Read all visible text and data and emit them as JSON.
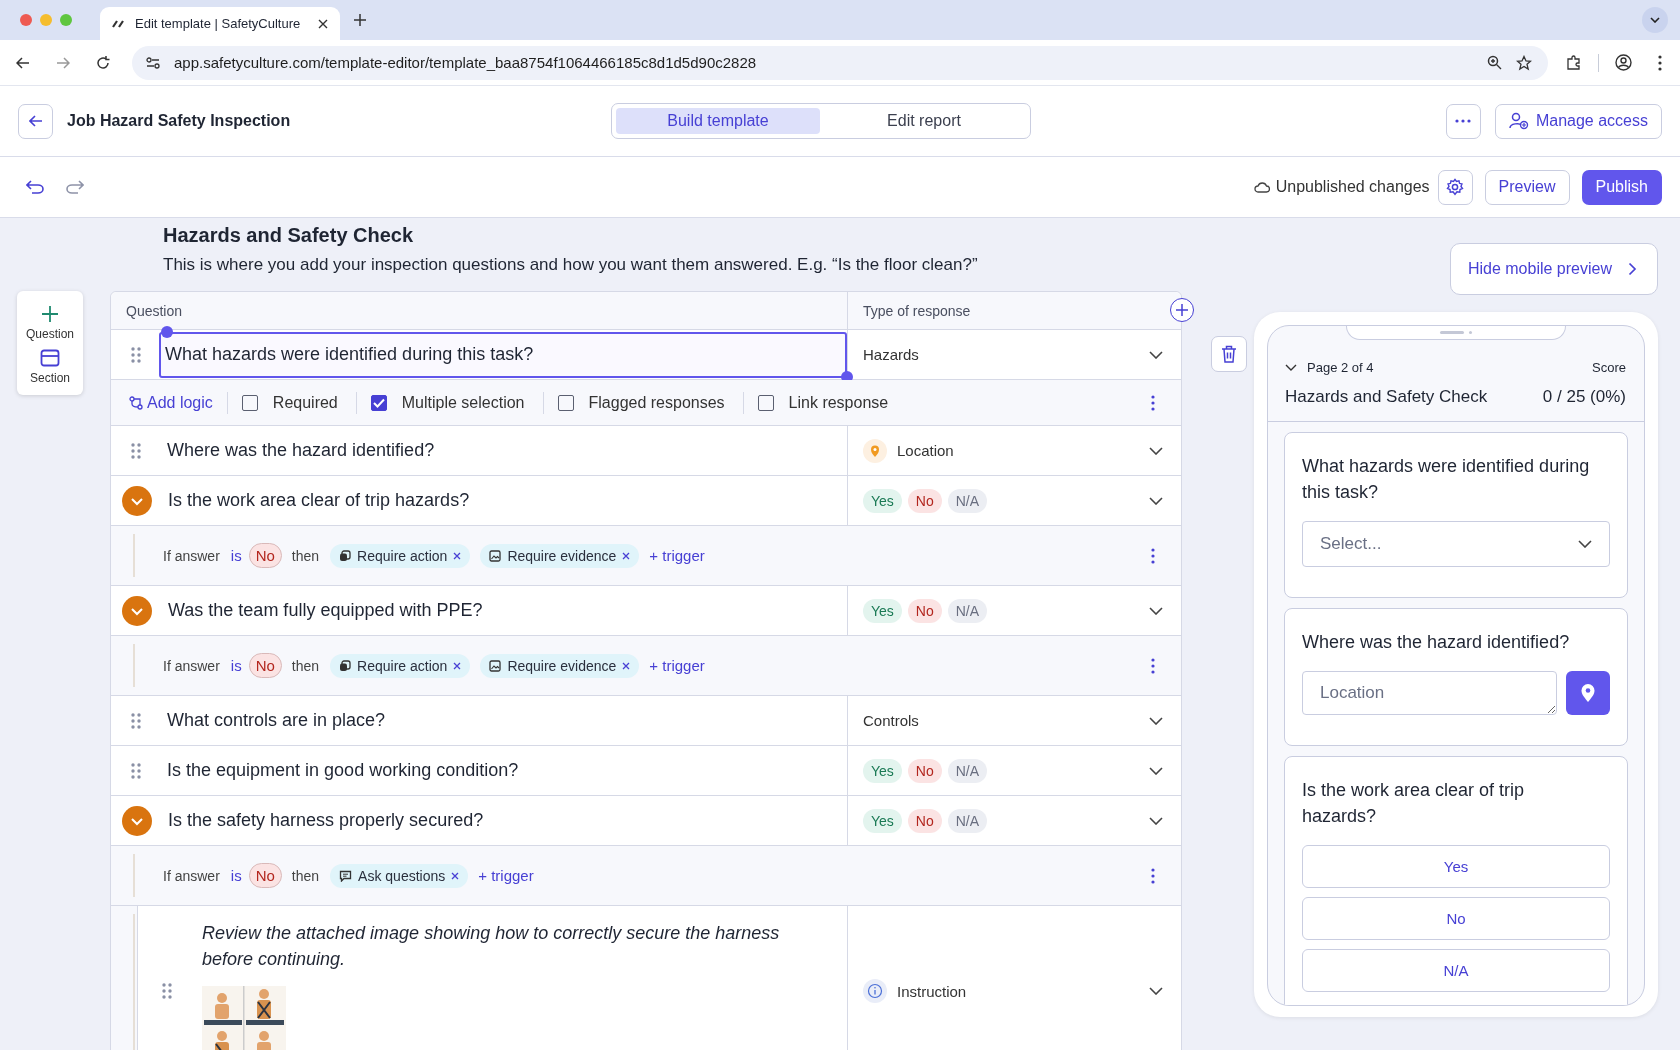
{
  "browser": {
    "tab_title": "Edit template | SafetyCulture",
    "url": "app.safetyculture.com/template-editor/template_baa8754f1064466185c8d1d5d90c2828"
  },
  "header": {
    "title": "Job Hazard Safety Inspection",
    "modes": [
      {
        "label": "Build template",
        "selected": true
      },
      {
        "label": "Edit report",
        "selected": false
      }
    ],
    "manage_access": "Manage access"
  },
  "toolbar": {
    "status": "Unpublished changes",
    "preview": "Preview",
    "publish": "Publish"
  },
  "section": {
    "title": "Hazards and Safety Check",
    "description": "This is where you add your inspection questions and how you want them answered. E.g. “Is the floor clean?”"
  },
  "add_panel": [
    {
      "kind": "question",
      "label": "Question"
    },
    {
      "kind": "section",
      "label": "Section"
    }
  ],
  "table": {
    "columns": [
      "Question",
      "Type of response"
    ],
    "rows": [
      {
        "kind": "question",
        "collapsible": false,
        "selected": true,
        "text": "What hazards were identified during this task?",
        "response": {
          "kind": "text",
          "label": "Hazards"
        }
      },
      {
        "kind": "options",
        "add_logic": "Add logic",
        "options": [
          {
            "label": "Required",
            "checked": false
          },
          {
            "label": "Multiple selection",
            "checked": true
          },
          {
            "label": "Flagged responses",
            "checked": false
          },
          {
            "label": "Link response",
            "checked": false
          }
        ]
      },
      {
        "kind": "question",
        "collapsible": false,
        "selected": false,
        "text": "Where was the hazard identified?",
        "response": {
          "kind": "location",
          "label": "Location"
        }
      },
      {
        "kind": "question",
        "collapsible": true,
        "selected": false,
        "text": "Is the work area clear of trip hazards?",
        "response": {
          "kind": "choices",
          "choices": [
            "Yes",
            "No",
            "N/A"
          ]
        }
      },
      {
        "kind": "trigger",
        "prefix": "If answer",
        "operator": "is",
        "answer": "No",
        "then": "then",
        "actions": [
          {
            "kind": "action",
            "label": "Require action"
          },
          {
            "kind": "evidence",
            "label": "Require evidence"
          },
          {
            "kind": "add",
            "label": "+ trigger"
          }
        ]
      },
      {
        "kind": "question",
        "collapsible": true,
        "selected": false,
        "text": "Was the team fully equipped with PPE?",
        "response": {
          "kind": "choices",
          "choices": [
            "Yes",
            "No",
            "N/A"
          ]
        }
      },
      {
        "kind": "trigger",
        "prefix": "If answer",
        "operator": "is",
        "answer": "No",
        "then": "then",
        "actions": [
          {
            "kind": "action",
            "label": "Require action"
          },
          {
            "kind": "evidence",
            "label": "Require evidence"
          },
          {
            "kind": "add",
            "label": "+ trigger"
          }
        ]
      },
      {
        "kind": "question",
        "collapsible": false,
        "selected": false,
        "text": "What controls are in place?",
        "response": {
          "kind": "text",
          "label": "Controls"
        }
      },
      {
        "kind": "question",
        "collapsible": false,
        "selected": false,
        "text": "Is the equipment in good working condition?",
        "response": {
          "kind": "choices",
          "choices": [
            "Yes",
            "No",
            "N/A"
          ]
        }
      },
      {
        "kind": "question",
        "collapsible": true,
        "selected": false,
        "text": "Is the safety harness properly secured?",
        "response": {
          "kind": "choices",
          "choices": [
            "Yes",
            "No",
            "N/A"
          ]
        }
      },
      {
        "kind": "trigger",
        "prefix": "If answer",
        "operator": "is",
        "answer": "No",
        "then": "then",
        "actions": [
          {
            "kind": "questions",
            "label": "Ask questions"
          },
          {
            "kind": "add",
            "label": "+ trigger"
          }
        ]
      },
      {
        "kind": "instruction",
        "text": "Review the attached image showing how to correctly secure the harness before continuing.",
        "response": {
          "kind": "instruction",
          "label": "Instruction"
        }
      }
    ]
  },
  "mobile_preview": {
    "toggle": "Hide mobile preview",
    "page": "Page 2 of 4",
    "score_label": "Score",
    "section_title": "Hazards and Safety Check",
    "score": "0 / 25 (0%)",
    "cards": [
      {
        "kind": "select",
        "question": "What hazards were identified during this task?",
        "placeholder": "Select..."
      },
      {
        "kind": "location",
        "question": "Where was the hazard identified?",
        "placeholder": "Location"
      },
      {
        "kind": "choices",
        "question": "Is the work area clear of trip hazards?",
        "choices": [
          "Yes",
          "No",
          "N/A"
        ]
      }
    ]
  }
}
